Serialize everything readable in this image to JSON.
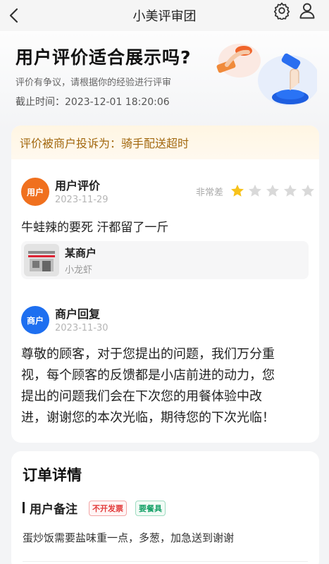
{
  "nav": {
    "title": "小美评审团",
    "back_icon": "chevron-left-icon",
    "settings_icon": "gear-icon",
    "profile_icon": "user-icon"
  },
  "hero": {
    "question": "用户评价适合展示吗?",
    "subtitle": "评价有争议，请根据你的经验进行评审",
    "deadline": "截止时间：2023-12-01 18:20:06"
  },
  "review_card": {
    "complaint": "评价被商户投诉为：骑手配送超时",
    "user_review": {
      "avatar_text": "用户",
      "author": "用户评价",
      "date": "2023-11-29",
      "rating_label": "非常差",
      "rating": 1,
      "rating_max": 5,
      "comment": "牛蛙辣的要死 汗都留了一斤"
    },
    "merchant": {
      "name": "某商户",
      "category": "小龙虾"
    },
    "merchant_reply": {
      "avatar_text": "商户",
      "author": "商户回复",
      "date": "2023-11-30",
      "lines": [
        "尊敬的顾客，对于您提出的问题，我们万分重",
        "视，每个顾客的反馈都是小店前进的动力，您",
        "提出的问题我们会在下次您的用餐体验中改",
        "进，谢谢您的本次光临，期待您的下次光临！"
      ]
    }
  },
  "order": {
    "title": "订单详情",
    "remark_label": "用户备注",
    "tags": [
      "不开发票",
      "要餐具"
    ],
    "note": "蛋炒饭需要盐味重一点，多葱，加急送到谢谢"
  },
  "colors": {
    "star_filled": "#f7c21b",
    "star_empty": "#d9d9d9",
    "user_avatar": "#f0701e",
    "merchant_avatar": "#1e6ff0",
    "complaint_text": "#a2680f"
  }
}
